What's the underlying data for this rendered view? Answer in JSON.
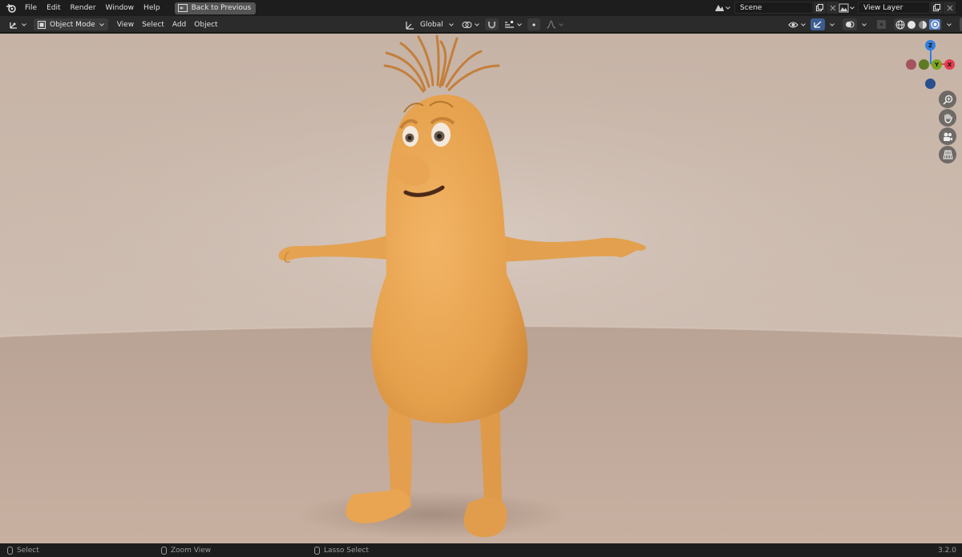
{
  "topbar": {
    "menu": [
      "File",
      "Edit",
      "Render",
      "Window",
      "Help"
    ],
    "back_label": "Back to Previous",
    "scene_value": "Scene",
    "view_layer_value": "View Layer"
  },
  "toolbar": {
    "mode_label": "Object Mode",
    "menus": [
      "View",
      "Select",
      "Add",
      "Object"
    ],
    "orientation_label": "Global"
  },
  "gizmo": {
    "z_label": "Z",
    "y_label": "Y",
    "x_label": "X",
    "colors": {
      "x": "#e63b4f",
      "y": "#7da21f",
      "z": "#2f7fe0",
      "neg_x": "#a5535e",
      "neg_y": "#5f7a25",
      "neg_z": "#2a4f8f"
    }
  },
  "statusbar": {
    "select": "Select",
    "zoom": "Zoom View",
    "lasso": "Lasso Select",
    "version": "3.2.0"
  },
  "colors": {
    "character": "#e8a552",
    "background_wall": "#cbb8aa",
    "floor": "#b9a091"
  }
}
